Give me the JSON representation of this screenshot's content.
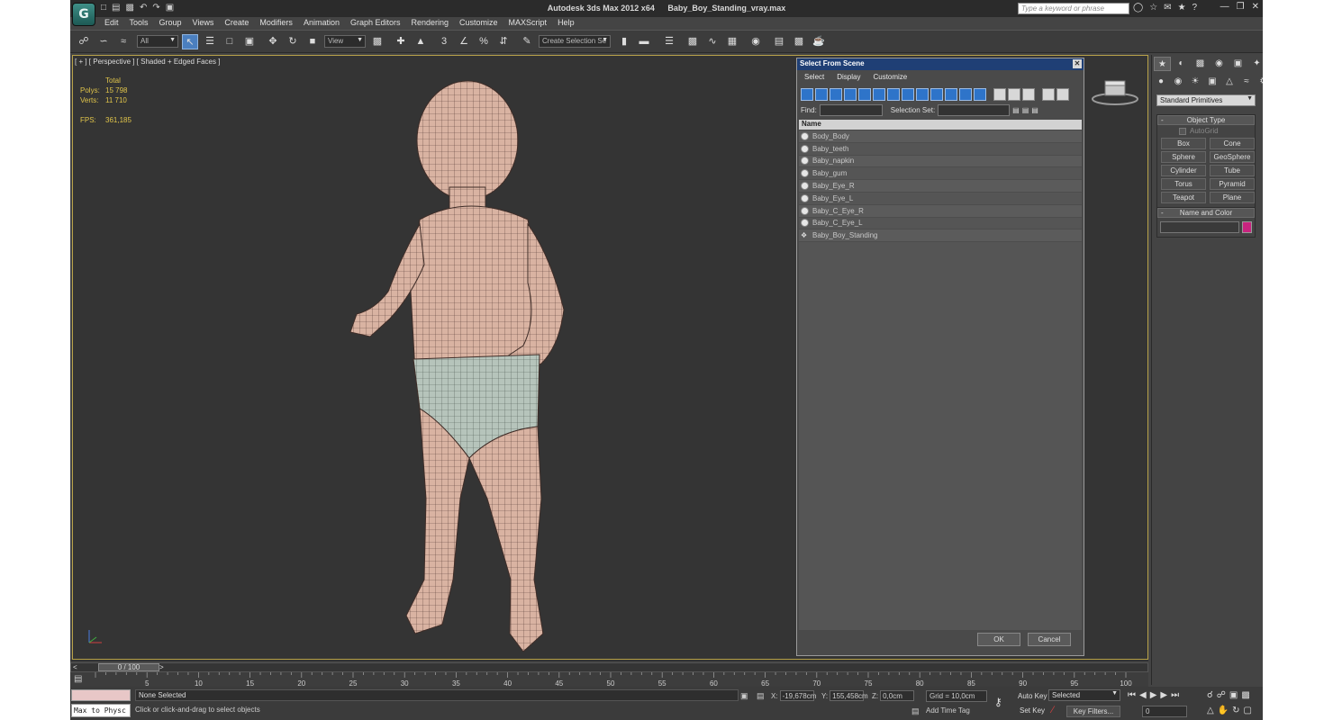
{
  "app": {
    "logo_letter": "G",
    "title_app": "Autodesk 3ds Max  2012 x64",
    "title_file": "Baby_Boy_Standing_vray.max",
    "search_placeholder": "Type a keyword or phrase"
  },
  "menu": [
    "Edit",
    "Tools",
    "Group",
    "Views",
    "Create",
    "Modifiers",
    "Animation",
    "Graph Editors",
    "Rendering",
    "Customize",
    "MAXScript",
    "Help"
  ],
  "toolbar": {
    "filter_value": "All",
    "refcoord_value": "View",
    "selection_set_placeholder": "Create Selection Se",
    "snap_3": "3",
    "snap_pct": "%"
  },
  "viewport": {
    "label": "[ + ] [ Perspective ] [ Shaded + Edged Faces ]",
    "stats_header": "Total",
    "polys_label": "Polys:",
    "polys_value": "15 798",
    "verts_label": "Verts:",
    "verts_value": "11 710",
    "fps_label": "FPS:",
    "fps_value": "361,185"
  },
  "dialog": {
    "title": "Select From Scene",
    "menu": [
      "Select",
      "Display",
      "Customize"
    ],
    "find_label": "Find:",
    "selset_label": "Selection Set:",
    "column_name": "Name",
    "objects": [
      "Body_Body",
      "Baby_teeth",
      "Baby_napkin",
      "Baby_gum",
      "Baby_Eye_R",
      "Baby_Eye_L",
      "Baby_C_Eye_R",
      "Baby_C_Eye_L",
      "Baby_Boy_Standing"
    ],
    "ok_label": "OK",
    "cancel_label": "Cancel"
  },
  "command_panel": {
    "primitive_type": "Standard Primitives",
    "object_type_title": "Object Type",
    "autogrid_label": "AutoGrid",
    "buttons": [
      "Box",
      "Cone",
      "Sphere",
      "GeoSphere",
      "Cylinder",
      "Tube",
      "Torus",
      "Pyramid",
      "Teapot",
      "Plane"
    ],
    "name_color_title": "Name and Color",
    "object_color": "#c8247f"
  },
  "timeline": {
    "frame_display": "0 / 100",
    "ticks": [
      "5",
      "10",
      "15",
      "20",
      "25",
      "30",
      "35",
      "40",
      "45",
      "50",
      "55",
      "60",
      "65",
      "70",
      "75",
      "80",
      "85",
      "90",
      "95",
      "100"
    ]
  },
  "status": {
    "listener_text": "Max to Physc",
    "selection_status": "None Selected",
    "prompt": "Click or click-and-drag to select objects",
    "x_label": "X:",
    "x_value": "-19,678cm",
    "y_label": "Y:",
    "y_value": "155,458cm",
    "z_label": "Z:",
    "z_value": "0,0cm",
    "grid": "Grid = 10,0cm",
    "add_time_tag": "Add Time Tag",
    "auto_key": "Auto Key",
    "set_key": "Set Key",
    "selected_value": "Selected",
    "key_filters": "Key Filters...",
    "current_frame": "0"
  }
}
